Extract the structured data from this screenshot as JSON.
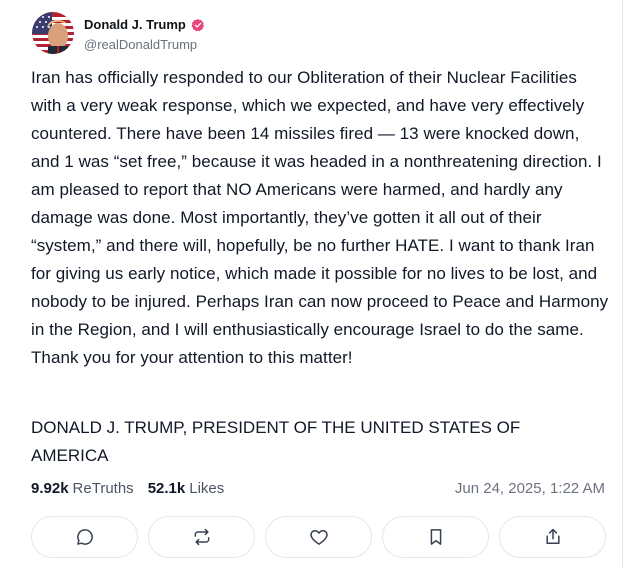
{
  "author": {
    "display_name": "Donald J. Trump",
    "handle": "@realDonaldTrump",
    "verified": true
  },
  "post": {
    "body": "Iran has officially responded to our Obliteration of their Nuclear Facilities with a very weak response, which we expected, and have very effectively countered. There have been 14 missiles fired — 13 were knocked down, and 1 was “set free,” because it was headed in a nonthreatening direction. I am pleased to report that NO Americans were harmed, and hardly any damage was done. Most importantly, they’ve gotten it all out of their “system,” and there will, hopefully, be no further HATE. I want to thank Iran for giving us early notice, which made it possible for no lives to be lost, and nobody to be injured. Perhaps Iran can now proceed to Peace and Harmony in the Region, and I will enthusiastically encourage Israel to do the same. Thank you for your attention to this matter!",
    "signature": "DONALD J. TRUMP, PRESIDENT OF THE UNITED STATES OF AMERICA"
  },
  "stats": {
    "retruths_count": "9.92k",
    "retruths_label": "ReTruths",
    "likes_count": "52.1k",
    "likes_label": "Likes",
    "timestamp": "Jun 24, 2025, 1:22 AM"
  },
  "actions": [
    {
      "icon": "reply-icon"
    },
    {
      "icon": "retruth-icon"
    },
    {
      "icon": "like-icon"
    },
    {
      "icon": "bookmark-icon"
    },
    {
      "icon": "share-icon"
    }
  ],
  "colors": {
    "verified_badge": "#e5457a",
    "icon_stroke": "#374151",
    "border": "#e5e7eb"
  }
}
